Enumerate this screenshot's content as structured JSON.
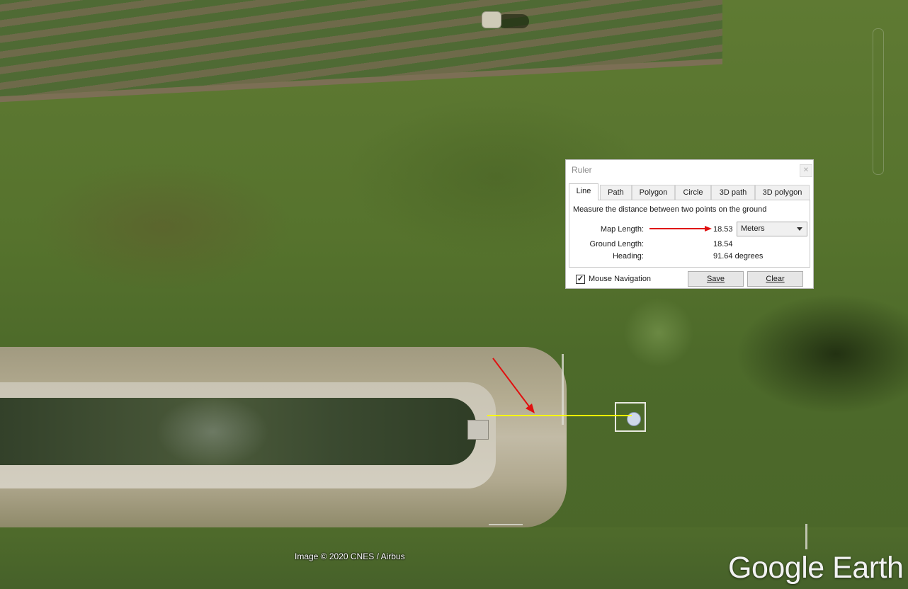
{
  "map": {
    "attribution": "Image © 2020 CNES / Airbus",
    "logo": "Google Earth",
    "measure_line_color": "#ffff00",
    "annotation_arrow_color": "#e01010"
  },
  "ruler": {
    "title": "Ruler",
    "close_icon": "close-icon",
    "tabs": [
      {
        "label": "Line",
        "active": true
      },
      {
        "label": "Path"
      },
      {
        "label": "Polygon"
      },
      {
        "label": "Circle"
      },
      {
        "label": "3D path"
      },
      {
        "label": "3D polygon"
      }
    ],
    "description": "Measure the distance between two points on the ground",
    "map_length_label": "Map Length:",
    "map_length_value": "18.53",
    "unit": "Meters",
    "ground_length_label": "Ground Length:",
    "ground_length_value": "18.54",
    "heading_label": "Heading:",
    "heading_value": "91.64 degrees",
    "mouse_navigation_label": "Mouse Navigation",
    "mouse_navigation_checked": true,
    "checkmark": "✓",
    "save_label": "Save",
    "clear_label": "Clear"
  }
}
